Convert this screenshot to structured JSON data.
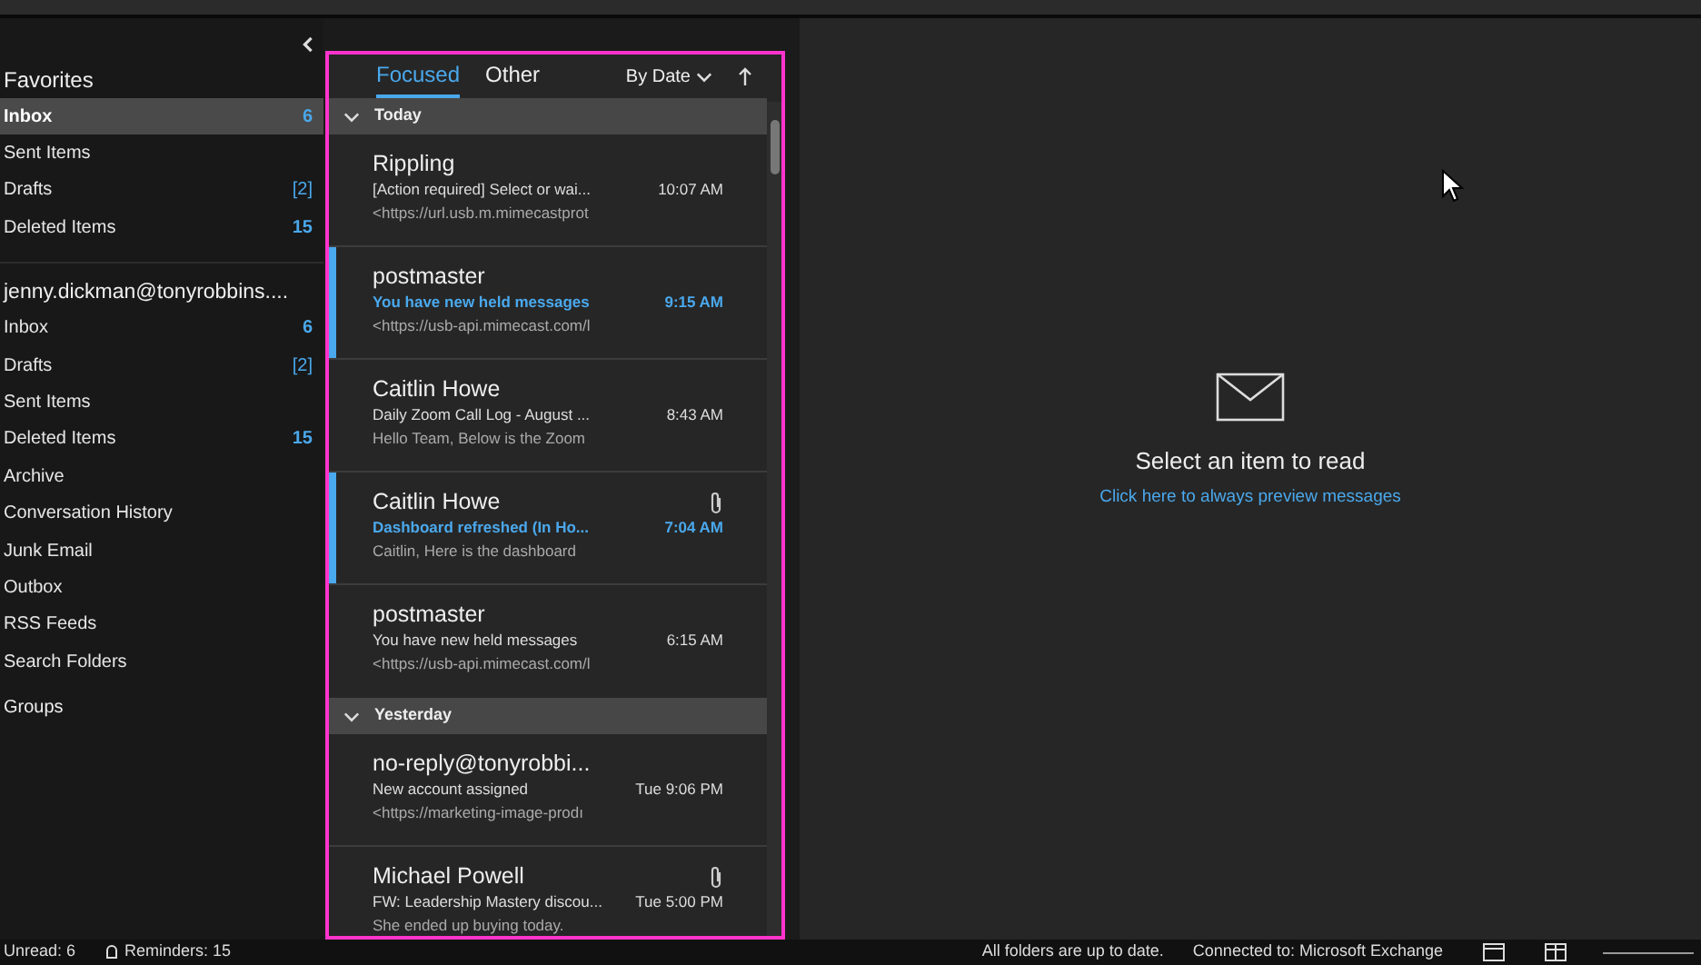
{
  "folder_pane": {
    "favorites": {
      "title": "Favorites",
      "items": [
        {
          "name": "Inbox",
          "count": "6",
          "kind": "unread",
          "selected": true
        },
        {
          "name": "Sent Items",
          "selected": false
        },
        {
          "name": "Drafts",
          "count": "[2]",
          "kind": "draft",
          "selected": false
        },
        {
          "name": "Deleted Items",
          "count": "15",
          "kind": "unread",
          "selected": false
        }
      ]
    },
    "account": {
      "title": "jenny.dickman@tonyrobbins....",
      "items": [
        {
          "name": "Inbox",
          "count": "6",
          "kind": "unread",
          "selected": false
        },
        {
          "name": "Drafts",
          "count": "[2]",
          "kind": "draft",
          "selected": false
        },
        {
          "name": "Sent Items",
          "selected": false
        },
        {
          "name": "Deleted Items",
          "count": "15",
          "kind": "unread",
          "selected": false
        },
        {
          "name": "Archive",
          "selected": false
        },
        {
          "name": "Conversation History",
          "selected": false
        },
        {
          "name": "Junk Email",
          "selected": false
        },
        {
          "name": "Outbox",
          "selected": false
        },
        {
          "name": "RSS Feeds",
          "selected": false
        },
        {
          "name": "Search Folders",
          "selected": false
        }
      ]
    },
    "groups": {
      "title": "Groups"
    }
  },
  "message_list": {
    "tabs": [
      {
        "label": "Focused",
        "selected": true
      },
      {
        "label": "Other",
        "selected": false
      }
    ],
    "sort": {
      "label": "By Date"
    },
    "groups": [
      {
        "title": "Today",
        "expanded": true,
        "messages": [
          {
            "sender": "Rippling",
            "subject": "[Action required] Select or wai...",
            "preview": "<https://url.usb.m.mimecastprot",
            "time": "10:07 AM",
            "unread": false,
            "attachment": false
          },
          {
            "sender": "postmaster",
            "subject": "You have new held messages",
            "preview": "<https://usb-api.mimecast.com/l",
            "time": "9:15 AM",
            "unread": true,
            "attachment": false
          },
          {
            "sender": "Caitlin Howe",
            "subject": "Daily Zoom Call Log - August ...",
            "preview": "Hello Team, Below is the Zoom",
            "time": "8:43 AM",
            "unread": false,
            "attachment": false
          },
          {
            "sender": "Caitlin Howe",
            "subject": "Dashboard refreshed (In Ho...",
            "preview": "Caitlin,  Here is the dashboard",
            "time": "7:04 AM",
            "unread": true,
            "attachment": true
          },
          {
            "sender": "postmaster",
            "subject": "You have new held messages",
            "preview": "<https://usb-api.mimecast.com/l",
            "time": "6:15 AM",
            "unread": false,
            "attachment": false
          }
        ]
      },
      {
        "title": "Yesterday",
        "expanded": true,
        "messages": [
          {
            "sender": "no-reply@tonyrobbi...",
            "subject": "New account assigned",
            "preview": "<https://marketing-image-prodı",
            "time": "Tue 9:06 PM",
            "unread": false,
            "attachment": false
          },
          {
            "sender": "Michael Powell",
            "subject": "FW: Leadership Mastery discou...",
            "preview": "She ended up buying today.",
            "time": "Tue 5:00 PM",
            "unread": false,
            "attachment": true
          }
        ]
      }
    ]
  },
  "reading_pane": {
    "message": "Select an item to read",
    "link": "Click here to always preview messages"
  },
  "status_bar": {
    "left": [
      "Unread: 6",
      "Reminders: 15"
    ],
    "right": [
      "All folders are up to date.",
      "Connected to: Microsoft Exchange"
    ]
  }
}
